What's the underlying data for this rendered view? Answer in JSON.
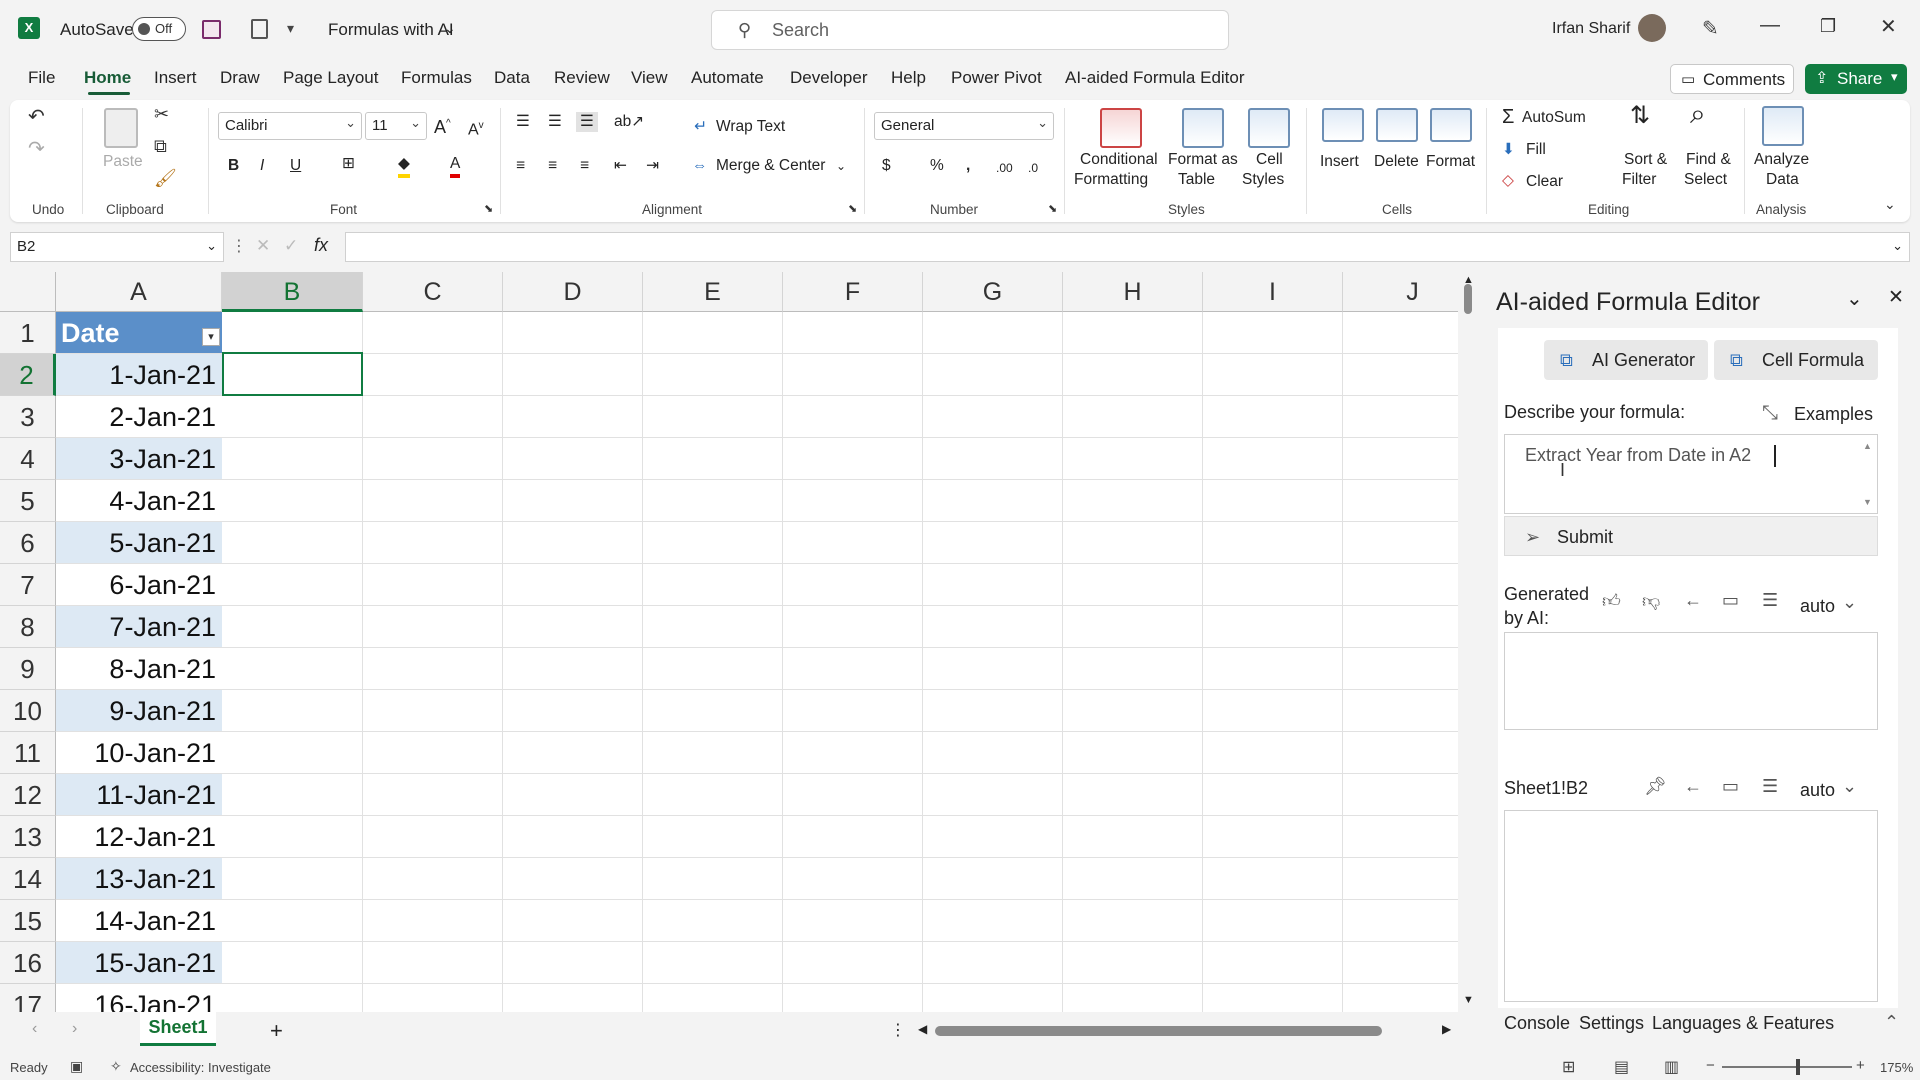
{
  "titlebar": {
    "autosave_label": "AutoSave",
    "autosave_state": "Off",
    "doc_title": "Formulas with AI",
    "search_placeholder": "Search",
    "user_name": "Irfan Sharif"
  },
  "menu": [
    "File",
    "Home",
    "Insert",
    "Draw",
    "Page Layout",
    "Formulas",
    "Data",
    "Review",
    "View",
    "Automate",
    "Developer",
    "Help",
    "Power Pivot",
    "AI-aided Formula Editor"
  ],
  "comments_label": "Comments",
  "share_label": "Share",
  "ribbon": {
    "groups": {
      "undo": "Undo",
      "clipboard": "Clipboard",
      "font": "Font",
      "alignment": "Alignment",
      "number": "Number",
      "styles": "Styles",
      "cells": "Cells",
      "editing": "Editing",
      "analysis": "Analysis"
    },
    "paste": "Paste",
    "font_name": "Calibri",
    "font_size": "11",
    "wrap_text": "Wrap Text",
    "merge_center": "Merge & Center",
    "number_format": "General",
    "conditional_formatting": [
      "Conditional",
      "Formatting"
    ],
    "format_as_table": [
      "Format as",
      "Table"
    ],
    "cell_styles": [
      "Cell",
      "Styles"
    ],
    "insert": "Insert",
    "delete": "Delete",
    "format": "Format",
    "autosum": "AutoSum",
    "fill": "Fill",
    "clear": "Clear",
    "sort_filter": [
      "Sort &",
      "Filter"
    ],
    "find_select": [
      "Find &",
      "Select"
    ],
    "analyze_data": [
      "Analyze",
      "Data"
    ]
  },
  "formula_bar": {
    "name_box": "B2",
    "formula": ""
  },
  "sheet": {
    "columns": [
      "A",
      "B",
      "C",
      "D",
      "E",
      "F",
      "G",
      "H",
      "I",
      "J"
    ],
    "rows": [
      "1",
      "2",
      "3",
      "4",
      "5",
      "6",
      "7",
      "8",
      "9",
      "10",
      "11",
      "12",
      "13",
      "14",
      "15",
      "16",
      "17"
    ],
    "header": "Date",
    "dates": [
      "1-Jan-21",
      "2-Jan-21",
      "3-Jan-21",
      "4-Jan-21",
      "5-Jan-21",
      "6-Jan-21",
      "7-Jan-21",
      "8-Jan-21",
      "9-Jan-21",
      "10-Jan-21",
      "11-Jan-21",
      "12-Jan-21",
      "13-Jan-21",
      "14-Jan-21",
      "15-Jan-21",
      "16-Jan-21"
    ],
    "tab_name": "Sheet1"
  },
  "status": {
    "ready": "Ready",
    "accessibility": "Accessibility: Investigate",
    "zoom": "175%"
  },
  "panel": {
    "title": "AI-aided Formula Editor",
    "tab_ai_generator": "AI Generator",
    "tab_cell_formula": "Cell Formula",
    "describe_label": "Describe your formula:",
    "examples_label": "Examples",
    "prompt_text": "Extract Year from Date in A2",
    "submit_label": "Submit",
    "generated_label": "Generated by AI:",
    "auto_label": "auto",
    "cell_ref": "Sheet1!B2",
    "bottom_tabs": [
      "Console",
      "Settings",
      "Languages & Features"
    ]
  },
  "colors": {
    "excel_green": "#107c41",
    "table_header": "#5b8fc9",
    "band": "#dde9f4"
  }
}
